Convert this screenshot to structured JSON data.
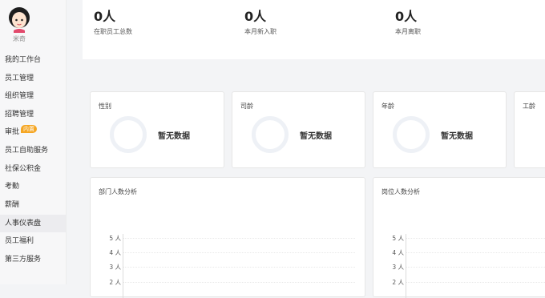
{
  "user": {
    "name": "米奇"
  },
  "sidebar": {
    "items": [
      {
        "label": "我的工作台"
      },
      {
        "label": "员工管理"
      },
      {
        "label": "组织管理"
      },
      {
        "label": "招聘管理"
      },
      {
        "label": "审批",
        "badge": "内置"
      },
      {
        "label": "员工自助服务"
      },
      {
        "label": "社保公积金"
      },
      {
        "label": "考勤"
      },
      {
        "label": "薪酬"
      },
      {
        "label": "人事仪表盘",
        "active": true
      },
      {
        "label": "员工福利"
      },
      {
        "label": "第三方服务"
      }
    ]
  },
  "stats": [
    {
      "value": "0人",
      "label": "在职员工总数"
    },
    {
      "value": "0人",
      "label": "本月新入职"
    },
    {
      "value": "0人",
      "label": "本月离职"
    }
  ],
  "cards": [
    {
      "title": "性别",
      "empty_text": "暂无数据"
    },
    {
      "title": "司龄",
      "empty_text": "暂无数据"
    },
    {
      "title": "年龄",
      "empty_text": "暂无数据"
    },
    {
      "title": "工龄"
    }
  ],
  "bar_charts": [
    {
      "title": "部门人数分析",
      "y_ticks": [
        "5 人",
        "4 人",
        "3 人",
        "2 人"
      ]
    },
    {
      "title": "岗位人数分析",
      "y_ticks": [
        "5 人",
        "4 人",
        "3 人",
        "2 人"
      ]
    }
  ],
  "colors": {
    "badge": "#f5a623",
    "donut": "#eef1f6"
  }
}
